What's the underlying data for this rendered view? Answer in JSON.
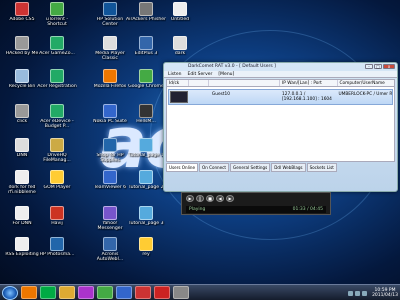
{
  "desktop": {
    "logo_text": "ac",
    "icons": [
      {
        "label": "Adobe CS5",
        "color": "#c33"
      },
      {
        "label": "uTorrent - Shortcut",
        "color": "#4a4"
      },
      {
        "label": "HP Solution Center",
        "color": "#159"
      },
      {
        "label": "AirAckers Phisher",
        "color": "#777"
      },
      {
        "label": "Untitled",
        "color": "#eee"
      },
      {
        "label": "HAcked by Me",
        "color": "#999"
      },
      {
        "label": "Acer GameZo...",
        "color": "#2a6"
      },
      {
        "label": "Media Player Classic",
        "color": "#ddd"
      },
      {
        "label": "EditPlus 3",
        "color": "#36a"
      },
      {
        "label": "dark",
        "color": "#ddd"
      },
      {
        "label": "Recycle Bin",
        "color": "#9bd"
      },
      {
        "label": "Acer Registration",
        "color": "#2a6"
      },
      {
        "label": "Mozilla Firefox",
        "color": "#e70"
      },
      {
        "label": "Google Chrome",
        "color": "#4a4"
      },
      {
        "label": "rock.jpg",
        "color": "#ccc"
      },
      {
        "label": "click",
        "color": "#999"
      },
      {
        "label": "Acer eDevice - Budget P...",
        "color": "#2a6"
      },
      {
        "label": "Nokia PC Suite",
        "color": "#36c"
      },
      {
        "label": "HellsM...",
        "color": "#333"
      },
      {
        "label": "DNN",
        "color": "#ddd"
      },
      {
        "label": "DriveHQ FileManag...",
        "color": "#ca4"
      },
      {
        "label": "Shop for HP Supplies",
        "color": "#26a"
      },
      {
        "label": "Tutorial_page 1",
        "color": "#5ad"
      },
      {
        "label": "dork for fed rfi.nibbleme",
        "color": "#eee"
      },
      {
        "label": "GOM Player",
        "color": "#fc3"
      },
      {
        "label": "TeamViewer 6",
        "color": "#36c"
      },
      {
        "label": "Tutorial_page 2",
        "color": "#5ad"
      },
      {
        "label": "For DNN",
        "color": "#eee"
      },
      {
        "label": "Havij",
        "color": "#c32"
      },
      {
        "label": "Yahoo! Messenger",
        "color": "#75c"
      },
      {
        "label": "Tutorial_page 3",
        "color": "#5ad"
      },
      {
        "label": "RSS Exploiting",
        "color": "#eee"
      },
      {
        "label": "HP Photosma...",
        "color": "#26a"
      },
      {
        "label": "Acronis AutoWebI...",
        "color": "#36a"
      },
      {
        "label": "rey",
        "color": "#fc3"
      }
    ]
  },
  "app_window": {
    "title": "DarkComet RAT v3.0 - [ Default Users ]",
    "menu": [
      "Listen",
      "Edit Server",
      "[Menu]"
    ],
    "columns": [
      "Id/ck",
      "",
      "",
      "IP Wan/[Lan] : Port",
      "Computer/UserName"
    ],
    "row": {
      "id": "",
      "country": "",
      "name": "Guest10",
      "ip": "127.0.0.1 / [192.168.1.100] : 1604",
      "user": "UMBERLOCK-PC / Umer Rock"
    },
    "tabs": [
      "Users Online",
      "On Connect",
      "General Settings",
      "Ddl WebBlags",
      "Sockets List"
    ]
  },
  "media_player": {
    "status": "Playing",
    "time": "01:33 / 04:45"
  },
  "taskbar": {
    "items": [
      "firefox",
      "dreamweaver",
      "explorer",
      "media",
      "chrome",
      "word",
      "paint",
      "opera",
      "app"
    ],
    "clock_time": "10:59 PM",
    "clock_date": "2011/04/13"
  }
}
